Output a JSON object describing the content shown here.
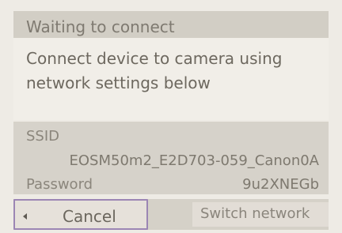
{
  "dialog": {
    "title": "Waiting to connect",
    "message_line_1": "Connect device to camera using",
    "message_line_2": "network settings below"
  },
  "network": {
    "ssid_label": "SSID",
    "ssid_value": "EOSM50m2_E2D703-059_Canon0A",
    "password_label": "Password",
    "password_value": "9u2XNEGb"
  },
  "buttons": {
    "cancel": "Cancel",
    "switch_network": "Switch network"
  }
}
